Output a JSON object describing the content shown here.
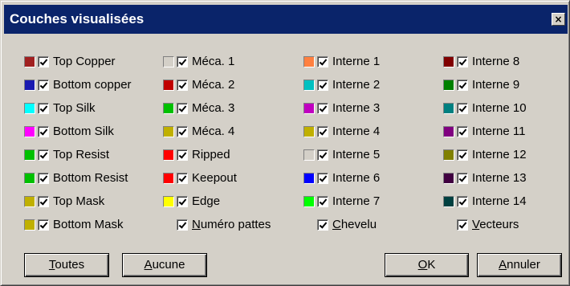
{
  "window": {
    "title": "Couches visualisées",
    "close_glyph": "×"
  },
  "columns": [
    {
      "items": [
        {
          "label": "Top Copper",
          "color": "#a02020",
          "checked": true
        },
        {
          "label": "Bottom copper",
          "color": "#1a1ab0",
          "checked": true
        },
        {
          "label": "Top Silk",
          "color": "#00ffff",
          "checked": true
        },
        {
          "label": "Bottom Silk",
          "color": "#ff00ff",
          "checked": true
        },
        {
          "label": "Top Resist",
          "color": "#00c000",
          "checked": true
        },
        {
          "label": "Bottom Resist",
          "color": "#00c000",
          "checked": true
        },
        {
          "label": "Top Mask",
          "color": "#c0b000",
          "checked": true
        },
        {
          "label": "Bottom Mask",
          "color": "#c0b000",
          "checked": true
        }
      ]
    },
    {
      "items": [
        {
          "label": "Méca. 1",
          "color": "#d4d0c8",
          "checked": true
        },
        {
          "label": "Méca. 2",
          "color": "#c00000",
          "checked": true
        },
        {
          "label": "Méca. 3",
          "color": "#00c000",
          "checked": true
        },
        {
          "label": "Méca. 4",
          "color": "#c0b000",
          "checked": true
        },
        {
          "label": "Ripped",
          "color": "#ff0000",
          "checked": true
        },
        {
          "label": "Keepout",
          "color": "#ff0000",
          "checked": true
        },
        {
          "label": "Edge",
          "color": "#ffff00",
          "checked": true
        },
        {
          "label": "Numéro pattes",
          "color": null,
          "checked": true,
          "underline": "N",
          "rest": "uméro pattes"
        }
      ]
    },
    {
      "items": [
        {
          "label": "Interne 1",
          "color": "#ff8040",
          "checked": true
        },
        {
          "label": "Interne 2",
          "color": "#00c0c0",
          "checked": true
        },
        {
          "label": "Interne 3",
          "color": "#c000c0",
          "checked": true
        },
        {
          "label": "Interne 4",
          "color": "#c0b000",
          "checked": true
        },
        {
          "label": "Interne 5",
          "color": "#d4d0c8",
          "checked": true
        },
        {
          "label": "Interne 6",
          "color": "#0000ff",
          "checked": true
        },
        {
          "label": "Interne 7",
          "color": "#00ff00",
          "checked": true
        },
        {
          "label": "Chevelu",
          "color": null,
          "checked": true,
          "underline": "C",
          "rest": "hevelu"
        }
      ]
    },
    {
      "items": [
        {
          "label": "Interne 8",
          "color": "#800000",
          "checked": true
        },
        {
          "label": "Interne 9",
          "color": "#008000",
          "checked": true
        },
        {
          "label": "Interne 10",
          "color": "#008080",
          "checked": true
        },
        {
          "label": "Interne 11",
          "color": "#800080",
          "checked": true
        },
        {
          "label": "Interne 12",
          "color": "#808000",
          "checked": true
        },
        {
          "label": "Interne 13",
          "color": "#400040",
          "checked": true
        },
        {
          "label": "Interne 14",
          "color": "#004040",
          "checked": true
        },
        {
          "label": "Vecteurs",
          "color": null,
          "checked": true,
          "underline": "V",
          "rest": "ecteurs"
        }
      ]
    }
  ],
  "buttons": {
    "toutes": {
      "u": "T",
      "rest": "outes"
    },
    "aucune": {
      "u": "A",
      "rest": "ucune"
    },
    "ok": {
      "u": "O",
      "rest": "K"
    },
    "annuler": {
      "u": "A",
      "rest": "nnuler"
    }
  }
}
